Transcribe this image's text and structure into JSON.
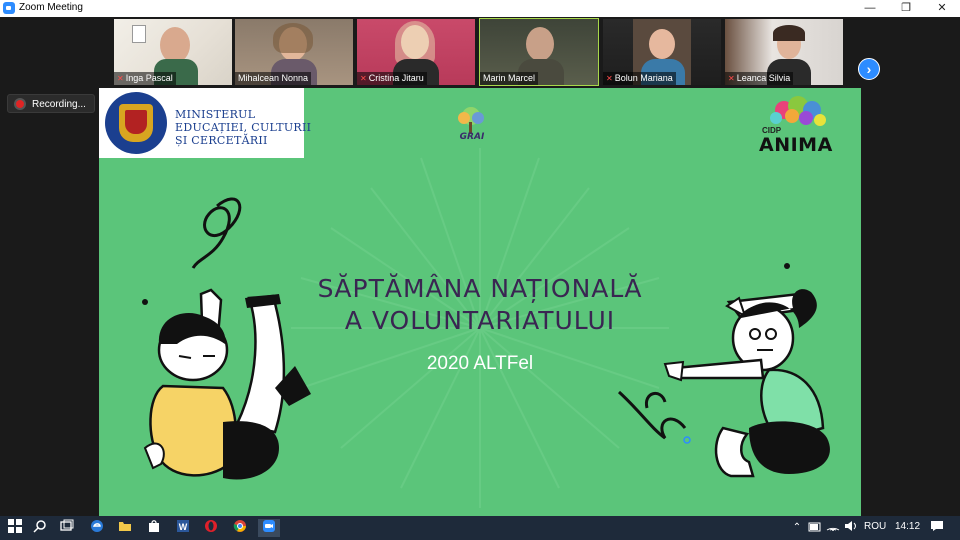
{
  "window": {
    "title": "Zoom Meeting",
    "minimize": "—",
    "restore": "❐",
    "close": "✕"
  },
  "participants": [
    {
      "name": "Inga Pascal",
      "muted": true
    },
    {
      "name": "Mihalcean Nonna",
      "muted": false
    },
    {
      "name": "Cristina Jitaru",
      "muted": true
    },
    {
      "name": "Marin Marcel",
      "muted": false,
      "active": true
    },
    {
      "name": "Bolun Mariana",
      "muted": true
    },
    {
      "name": "Leanca Silvia",
      "muted": true
    }
  ],
  "strip": {
    "next_icon": "›"
  },
  "recording": {
    "label": "Recording..."
  },
  "slide": {
    "ministry": {
      "line1": "MINISTERUL",
      "line2": "EDUCAȚIEI, CULTURII",
      "line3": "ȘI CERCETĂRII"
    },
    "grai_logo": "GRAI",
    "anima_logo": {
      "small": "CIDP",
      "name": "ANIMA"
    },
    "headline_line1": "SĂPTĂMÂNA NAȚIONALĂ",
    "headline_line2": "A VOLUNTARIATULUI",
    "subline": "2020 ALTFel",
    "colors": {
      "background": "#5bc57a",
      "headline": "#3a2552",
      "boy_shirt": "#f6d366",
      "girl_shirt": "#7fe0a8"
    }
  },
  "taskbar": {
    "icons": [
      "windows-start-icon",
      "search-icon",
      "task-view-icon",
      "edge-icon",
      "file-explorer-icon",
      "store-icon",
      "word-icon",
      "opera-icon",
      "chrome-icon",
      "zoom-icon"
    ],
    "language": "ROU",
    "time": "14:12"
  }
}
